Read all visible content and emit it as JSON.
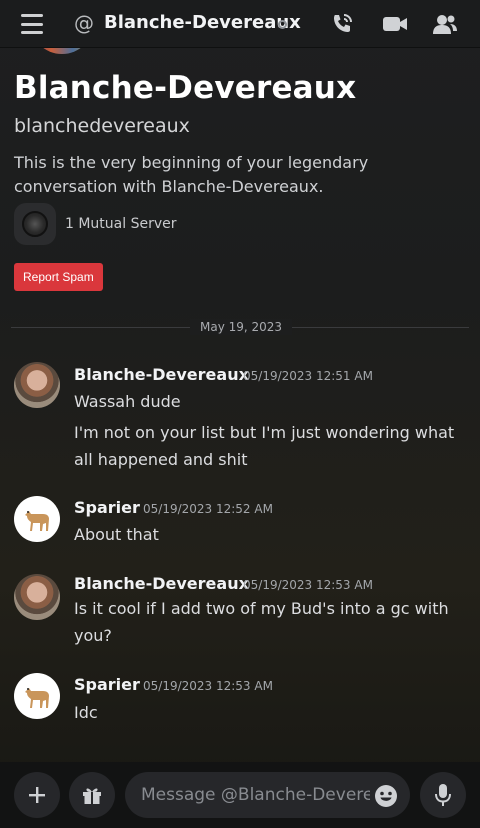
{
  "header": {
    "title": "Blanche-Devereaux",
    "icons": [
      "menu-icon",
      "at-icon",
      "call-icon",
      "video-icon",
      "members-icon"
    ]
  },
  "profile": {
    "display_name": "Blanche-Devereaux",
    "username": "blanchedevereaux",
    "intro": "This is the very beginning of your legendary conversation with Blanche-Devereaux.",
    "mutual_servers": "1 Mutual Server",
    "report_label": "Report Spam"
  },
  "date_divider": "May 19, 2023",
  "messages": [
    {
      "author": "Blanche-Devereaux",
      "timestamp": "05/19/2023 12:51 AM",
      "lines": [
        "Wassah dude",
        "I'm not on your list but I'm just wondering what all happened and shit"
      ]
    },
    {
      "author": "Sparier",
      "timestamp": "05/19/2023 12:52 AM",
      "lines": [
        "About that"
      ]
    },
    {
      "author": "Blanche-Devereaux",
      "timestamp": "05/19/2023 12:53 AM",
      "lines": [
        "Is it cool if I add two of my Bud's into a gc with you?"
      ]
    },
    {
      "author": "Sparier",
      "timestamp": "05/19/2023 12:53 AM",
      "lines": [
        "Idc"
      ]
    }
  ],
  "composer": {
    "placeholder": "Message @Blanche-Deverea..."
  },
  "colors": {
    "report": "#da373c",
    "background": "#1e1f20"
  }
}
